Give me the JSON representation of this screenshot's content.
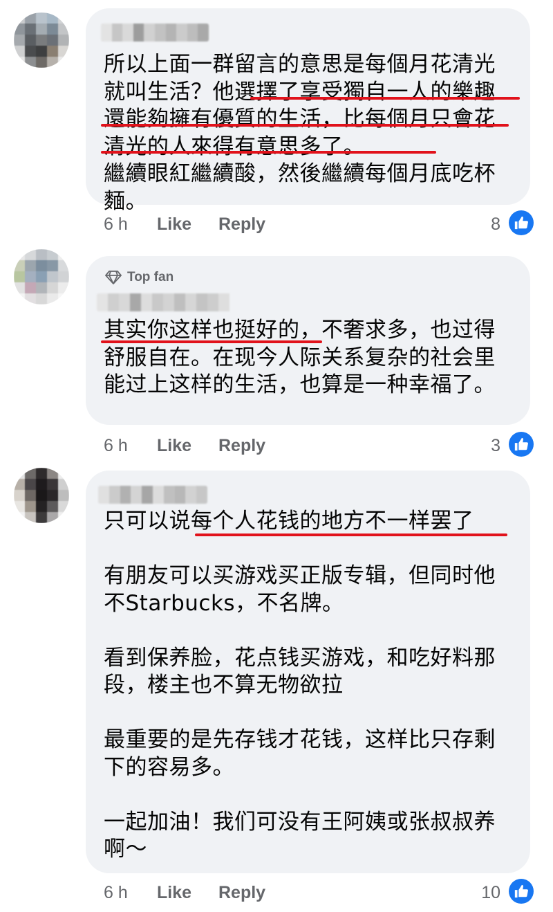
{
  "colors": {
    "bubble": "#f0f2f5",
    "text": "#050505",
    "meta": "#65676b",
    "like_badge": "#1877f2",
    "underline": "#e1121b"
  },
  "comments": [
    {
      "author_blurred": true,
      "top_fan": "",
      "text": "所以上面一群留言的意思是每個月花清光就叫生活？他選擇了享受獨自一人的樂趣還能夠擁有優質的生活，比每個月只會花清光的人來得有意思多了。\n繼續眼紅繼續酸，然後繼續每個月底吃杯麵。",
      "time": "6 h",
      "like": "Like",
      "reply": "Reply",
      "reactions": "8",
      "reaction_icon": "thumbs-up-icon"
    },
    {
      "author_blurred": true,
      "top_fan": "Top fan",
      "top_fan_icon": "diamond-icon",
      "text": "其实你这样也挺好的，不奢求多，也过得舒服自在。在现今人际关系复杂的社会里能过上这样的生活，也算是一种幸福了。",
      "time": "6 h",
      "like": "Like",
      "reply": "Reply",
      "reactions": "3",
      "reaction_icon": "thumbs-up-icon"
    },
    {
      "author_blurred": true,
      "top_fan": "",
      "text": "只可以说每个人花钱的地方不一样罢了\n\n有朋友可以买游戏买正版专辑，但同时他不Starbucks，不名牌。\n\n看到保养脸，花点钱买游戏，和吃好料那段，楼主也不算无物欲拉\n\n最重要的是先存钱才花钱，这样比只存剩下的容易多。\n\n一起加油！我们可没有王阿姨或张叔叔养啊～",
      "time": "6 h",
      "like": "Like",
      "reply": "Reply",
      "reactions": "10",
      "reaction_icon": "thumbs-up-icon"
    }
  ]
}
